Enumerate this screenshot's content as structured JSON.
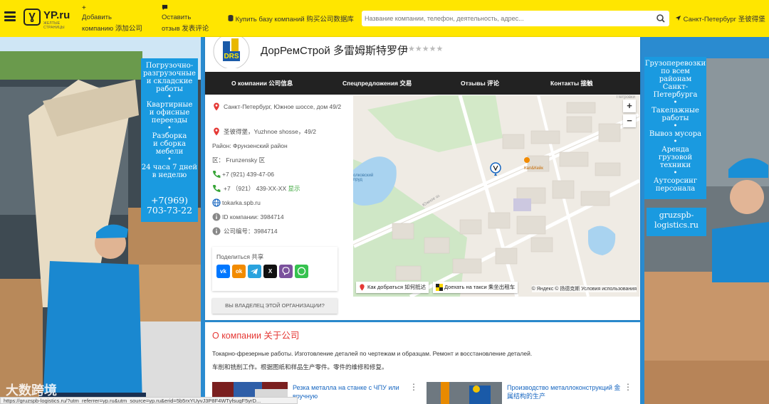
{
  "header": {
    "logo_text": "YP.ru",
    "logo_sub": "ЖЕЛТЫЕ СТРАНИЦЫ",
    "add_company": {
      "line1": "Добавить",
      "line2": "компанию  添加公司"
    },
    "leave_review": {
      "line1": "Оставить",
      "line2": "отзыв  发表评论"
    },
    "buy_db": "Купить базу компаний  购买公司数据库",
    "search_placeholder": "Название компании, телефон, деятельность, адрес...",
    "city": "Санкт-Петербург  圣彼得堡"
  },
  "left_ad": {
    "services": "Погрузочно-\nразгрузочные\nи складские\nработы\n•\nКвартирные\nи офисные\nпереезды\n•\nРазборка\nи сборка\nмебели\n•\n24 часа 7 дней\nв неделю",
    "phone": "+7(969)\n703-73-22"
  },
  "right_ad": {
    "services": "Грузоперевозки\nпо всем\nрайонам\nСанкт-\nПетербурга\n•\nТакелажные\nработы\n•\nВывоз мусора\n•\nАренда\nгрузовой\nтехники\n•\nАутсорсинг\nперсонала",
    "site": "gruzspb-\nlogistics.ru"
  },
  "company": {
    "logo_text": "DRS",
    "title": "ДорРемСтрой  多雷姆斯特罗伊",
    "rating_stars": "★★★★★",
    "rating": 0
  },
  "tabs": [
    {
      "label": "О компании  公司信息"
    },
    {
      "label": "Спецпредложения  交易"
    },
    {
      "label": "Отзывы  评论"
    },
    {
      "label": "Контакты  接触"
    }
  ],
  "info": {
    "address_ru": "Санкт-Петербург, Южное шоссе, дом 49/2",
    "address_zh": "圣彼得堡，Yuzhnoe shosse，49/2",
    "district_ru": "Район: Фрунзенский район",
    "district_zh": "区： Frunzensky 区",
    "phone1": "+7 (921) 439-47-06",
    "phone2": "+7  （921）  439-XX-XX",
    "show": "显示",
    "site": "tokarka.spb.ru",
    "id_ru": "ID компании: 3984714",
    "id_zh": "公司编号：3984714"
  },
  "share": {
    "label": "Поделиться  共享",
    "networks": [
      "vk-icon",
      "ok-icon",
      "telegram-icon",
      "x-icon",
      "viber-icon",
      "whatsapp-icon"
    ]
  },
  "owner_button": "ВЫ ВЛАДЕЛЕЦ ЭТОЙ ОРГАНИЗАЦИИ?",
  "map": {
    "route_button": "Как добраться  如何抵达",
    "taxi_button": "Доехать на такси  乘坐出租车",
    "legal": "© Яндекс  © 扬德克斯  Условия использования",
    "zoom_in": "+",
    "zoom_out": "−",
    "labels": {
      "cafe": "Кап&Кейк",
      "pond": "олковский\nпруд",
      "road": "Южное ш.",
      "area": "Петровки"
    }
  },
  "about": {
    "title": "О компании  关于公司",
    "text_ru": "Токарно-фрезерные работы. Изготовление деталей по чертежам и образцам. Ремонт и восстановление деталей.",
    "text_zh": "车削和铣削工作。根据图纸和样品生产零件。零件的维修和修复。",
    "news": [
      {
        "title": "Резка металла на станке с ЧПУ или вручную"
      },
      {
        "title": "Производство металлоконструкций  金属结构的生产"
      }
    ]
  },
  "status_url": "https://gruzspb-logistics.ru/?utm_referrer=yp.ru&utm_source=yp.ru&erid=5b5rxYUyvJ3P8F4WTyfsugF5yrD...",
  "watermark": "大数跨境",
  "colors": {
    "yellow": "#ffe600",
    "brand_blue": "#1a9ae0",
    "accent_red": "#e53935",
    "link_blue": "#1565c0"
  }
}
